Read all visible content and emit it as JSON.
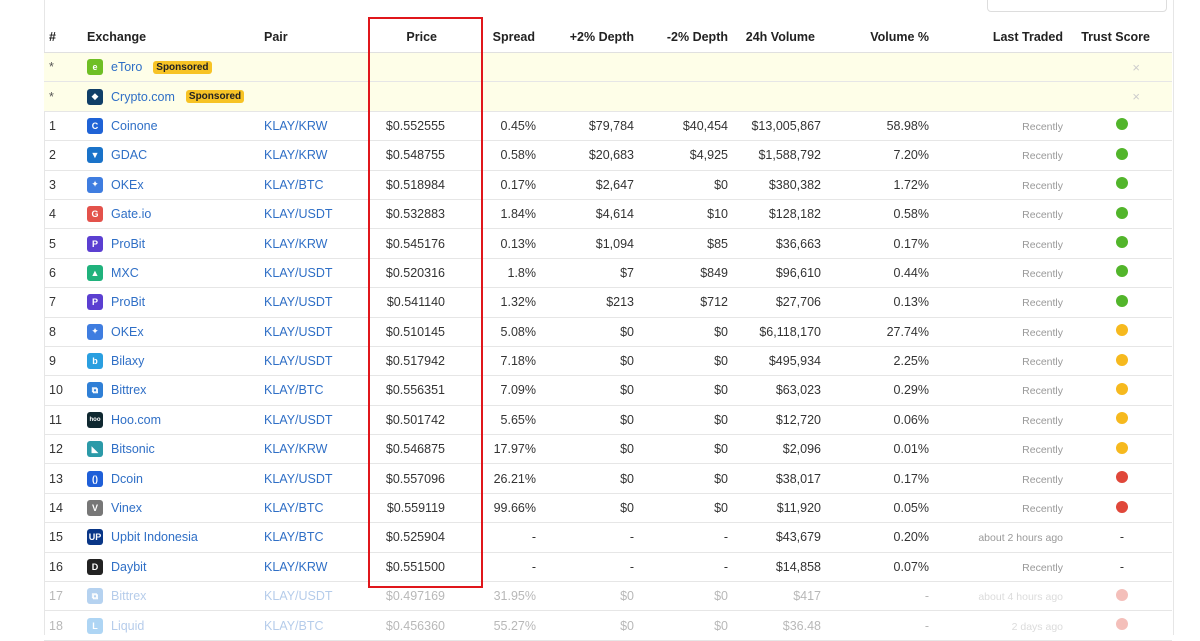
{
  "header": {
    "columns": [
      "#",
      "Exchange",
      "Pair",
      "Price",
      "Spread",
      "+2% Depth",
      "-2% Depth",
      "24h Volume",
      "Volume %",
      "Last Traded",
      "Trust Score"
    ]
  },
  "sponsored": [
    {
      "rank": "*",
      "exchange": "eToro",
      "badge": "Sponsored",
      "logo_color": "#6fbf25",
      "logo_glyph": "e"
    },
    {
      "rank": "*",
      "exchange": "Crypto.com",
      "badge": "Sponsored",
      "logo_color": "#103f68",
      "logo_glyph": "◆"
    }
  ],
  "rows": [
    {
      "rank": "1",
      "exchange": "Coinone",
      "pair": "KLAY/KRW",
      "price": "$0.552555",
      "spread": "0.45%",
      "depth_plus": "$79,784",
      "depth_minus": "$40,454",
      "volume": "$13,005,867",
      "volume_pct": "58.98%",
      "last": "Recently",
      "trust": "#52b52b",
      "logo_color": "#1f63d6",
      "logo_glyph": "C"
    },
    {
      "rank": "2",
      "exchange": "GDAC",
      "pair": "KLAY/KRW",
      "price": "$0.548755",
      "spread": "0.58%",
      "depth_plus": "$20,683",
      "depth_minus": "$4,925",
      "volume": "$1,588,792",
      "volume_pct": "7.20%",
      "last": "Recently",
      "trust": "#52b52b",
      "logo_color": "#1a73c9",
      "logo_glyph": "▼"
    },
    {
      "rank": "3",
      "exchange": "OKEx",
      "pair": "KLAY/BTC",
      "price": "$0.518984",
      "spread": "0.17%",
      "depth_plus": "$2,647",
      "depth_minus": "$0",
      "volume": "$380,382",
      "volume_pct": "1.72%",
      "last": "Recently",
      "trust": "#52b52b",
      "logo_color": "#3f7de0",
      "logo_glyph": "✦"
    },
    {
      "rank": "4",
      "exchange": "Gate.io",
      "pair": "KLAY/USDT",
      "price": "$0.532883",
      "spread": "1.84%",
      "depth_plus": "$4,614",
      "depth_minus": "$10",
      "volume": "$128,182",
      "volume_pct": "0.58%",
      "last": "Recently",
      "trust": "#52b52b",
      "logo_color": "#e3524b",
      "logo_glyph": "G"
    },
    {
      "rank": "5",
      "exchange": "ProBit",
      "pair": "KLAY/KRW",
      "price": "$0.545176",
      "spread": "0.13%",
      "depth_plus": "$1,094",
      "depth_minus": "$85",
      "volume": "$36,663",
      "volume_pct": "0.17%",
      "last": "Recently",
      "trust": "#52b52b",
      "logo_color": "#5b3fd1",
      "logo_glyph": "P"
    },
    {
      "rank": "6",
      "exchange": "MXC",
      "pair": "KLAY/USDT",
      "price": "$0.520316",
      "spread": "1.8%",
      "depth_plus": "$7",
      "depth_minus": "$849",
      "volume": "$96,610",
      "volume_pct": "0.44%",
      "last": "Recently",
      "trust": "#52b52b",
      "logo_color": "#20b27c",
      "logo_glyph": "▲"
    },
    {
      "rank": "7",
      "exchange": "ProBit",
      "pair": "KLAY/USDT",
      "price": "$0.541140",
      "spread": "1.32%",
      "depth_plus": "$213",
      "depth_minus": "$712",
      "volume": "$27,706",
      "volume_pct": "0.13%",
      "last": "Recently",
      "trust": "#52b52b",
      "logo_color": "#5b3fd1",
      "logo_glyph": "P"
    },
    {
      "rank": "8",
      "exchange": "OKEx",
      "pair": "KLAY/USDT",
      "price": "$0.510145",
      "spread": "5.08%",
      "depth_plus": "$0",
      "depth_minus": "$0",
      "volume": "$6,118,170",
      "volume_pct": "27.74%",
      "last": "Recently",
      "trust": "#f6b91e",
      "logo_color": "#3f7de0",
      "logo_glyph": "✦"
    },
    {
      "rank": "9",
      "exchange": "Bilaxy",
      "pair": "KLAY/USDT",
      "price": "$0.517942",
      "spread": "7.18%",
      "depth_plus": "$0",
      "depth_minus": "$0",
      "volume": "$495,934",
      "volume_pct": "2.25%",
      "last": "Recently",
      "trust": "#f6b91e",
      "logo_color": "#2a9fe0",
      "logo_glyph": "b"
    },
    {
      "rank": "10",
      "exchange": "Bittrex",
      "pair": "KLAY/BTC",
      "price": "$0.556351",
      "spread": "7.09%",
      "depth_plus": "$0",
      "depth_minus": "$0",
      "volume": "$63,023",
      "volume_pct": "0.29%",
      "last": "Recently",
      "trust": "#f6b91e",
      "logo_color": "#2f7fd6",
      "logo_glyph": "⧉"
    },
    {
      "rank": "11",
      "exchange": "Hoo.com",
      "pair": "KLAY/USDT",
      "price": "$0.501742",
      "spread": "5.65%",
      "depth_plus": "$0",
      "depth_minus": "$0",
      "volume": "$12,720",
      "volume_pct": "0.06%",
      "last": "Recently",
      "trust": "#f6b91e",
      "logo_color": "#0f2830",
      "logo_glyph": "hoo"
    },
    {
      "rank": "12",
      "exchange": "Bitsonic",
      "pair": "KLAY/KRW",
      "price": "$0.546875",
      "spread": "17.97%",
      "depth_plus": "$0",
      "depth_minus": "$0",
      "volume": "$2,096",
      "volume_pct": "0.01%",
      "last": "Recently",
      "trust": "#f6b91e",
      "logo_color": "#2b9aa8",
      "logo_glyph": "◣"
    },
    {
      "rank": "13",
      "exchange": "Dcoin",
      "pair": "KLAY/USDT",
      "price": "$0.557096",
      "spread": "26.21%",
      "depth_plus": "$0",
      "depth_minus": "$0",
      "volume": "$38,017",
      "volume_pct": "0.17%",
      "last": "Recently",
      "trust": "#e0473a",
      "logo_color": "#1f5fd8",
      "logo_glyph": "()"
    },
    {
      "rank": "14",
      "exchange": "Vinex",
      "pair": "KLAY/BTC",
      "price": "$0.559119",
      "spread": "99.66%",
      "depth_plus": "$0",
      "depth_minus": "$0",
      "volume": "$11,920",
      "volume_pct": "0.05%",
      "last": "Recently",
      "trust": "#e0473a",
      "logo_color": "#777777",
      "logo_glyph": "V"
    },
    {
      "rank": "15",
      "exchange": "Upbit Indonesia",
      "pair": "KLAY/BTC",
      "price": "$0.525904",
      "spread": "-",
      "depth_plus": "-",
      "depth_minus": "-",
      "volume": "$43,679",
      "volume_pct": "0.20%",
      "last": "about 2 hours ago",
      "trust": "-",
      "logo_color": "#093687",
      "logo_glyph": "UP"
    },
    {
      "rank": "16",
      "exchange": "Daybit",
      "pair": "KLAY/KRW",
      "price": "$0.551500",
      "spread": "-",
      "depth_plus": "-",
      "depth_minus": "-",
      "volume": "$14,858",
      "volume_pct": "0.07%",
      "last": "Recently",
      "trust": "-",
      "logo_color": "#222222",
      "logo_glyph": "D"
    },
    {
      "rank": "17",
      "exchange": "Bittrex",
      "pair": "KLAY/USDT",
      "price": "$0.497169",
      "spread": "31.95%",
      "depth_plus": "$0",
      "depth_minus": "$0",
      "volume": "$417",
      "volume_pct": "-",
      "last": "about 4 hours ago",
      "trust": "#e0473a",
      "logo_color": "#2f7fd6",
      "logo_glyph": "⧉",
      "faded": true
    },
    {
      "rank": "18",
      "exchange": "Liquid",
      "pair": "KLAY/BTC",
      "price": "$0.456360",
      "spread": "55.27%",
      "depth_plus": "$0",
      "depth_minus": "$0",
      "volume": "$36.48",
      "volume_pct": "-",
      "last": "2 days ago",
      "trust": "#e0473a",
      "logo_color": "#1b8ae0",
      "logo_glyph": "L",
      "faded": true
    }
  ],
  "colors": {
    "highlight": "#e0161b",
    "link": "#2f6fc6",
    "sponsored_bg": "#fefee8"
  }
}
